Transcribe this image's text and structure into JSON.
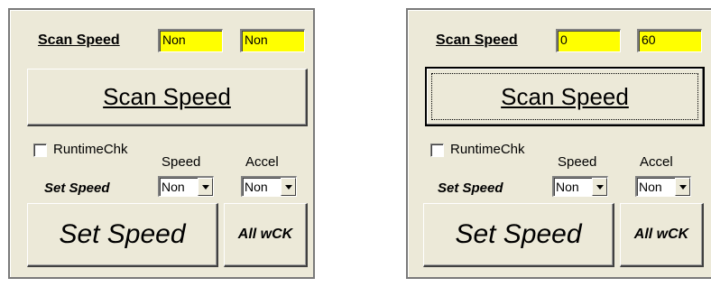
{
  "panels": [
    {
      "scan_speed_label": "Scan Speed",
      "scan_speed_value1": "Non",
      "scan_speed_value2": "Non",
      "scan_speed_button": "Scan Speed",
      "runtime_chk_label": "RuntimeChk",
      "runtime_chk_checked": false,
      "speed_label": "Speed",
      "accel_label": "Accel",
      "set_speed_label": "Set Speed",
      "speed_select": "Non",
      "accel_select": "Non",
      "set_speed_button": "Set Speed",
      "all_wck_button": "All wCK"
    },
    {
      "scan_speed_label": "Scan Speed",
      "scan_speed_value1": "0",
      "scan_speed_value2": "60",
      "scan_speed_button": "Scan Speed",
      "scan_speed_button_focused": true,
      "runtime_chk_label": "RuntimeChk",
      "runtime_chk_checked": false,
      "speed_label": "Speed",
      "accel_label": "Accel",
      "set_speed_label": "Set Speed",
      "speed_select": "Non",
      "accel_select": "Non",
      "set_speed_button": "Set Speed",
      "all_wck_button": "All wCK"
    }
  ],
  "colors": {
    "panel_bg": "#ece9d8",
    "value_field_bg": "#ffff00"
  }
}
